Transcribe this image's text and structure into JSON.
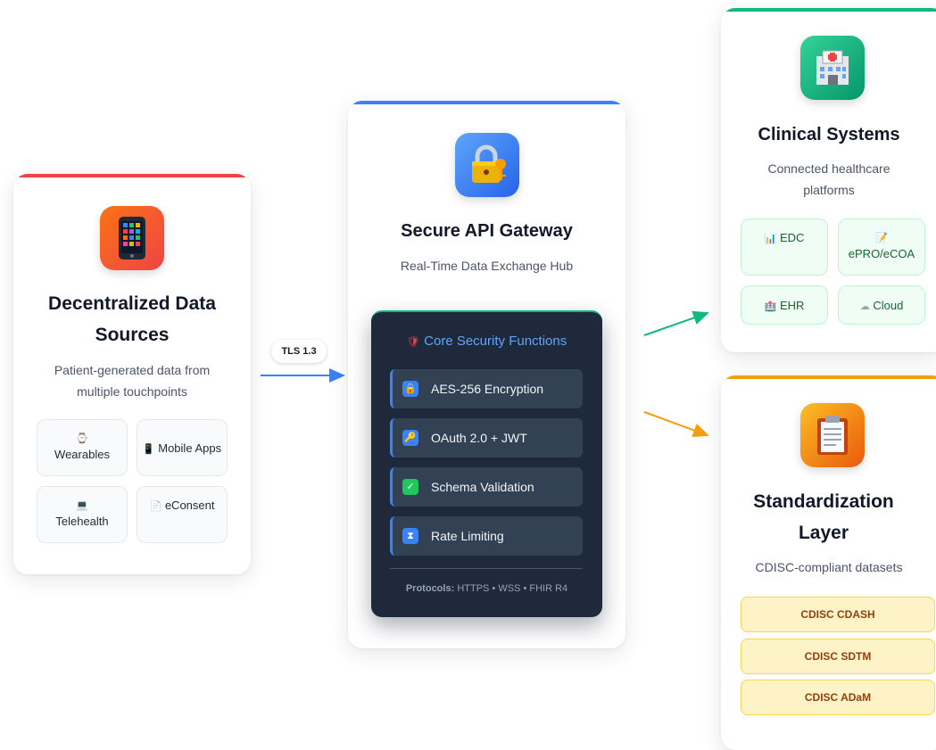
{
  "sources": {
    "title": "Decentralized Data Sources",
    "subtitle": "Patient-generated data from multiple touchpoints",
    "chips": [
      {
        "glyph": "⌚",
        "label": "Wearables"
      },
      {
        "glyph": "📱",
        "label": "Mobile Apps"
      },
      {
        "glyph": "💻",
        "label": "Telehealth"
      },
      {
        "glyph": "📄",
        "label": "eConsent"
      }
    ]
  },
  "connector": {
    "tls_label": "TLS 1.3"
  },
  "gateway": {
    "title": "Secure API Gateway",
    "subtitle": "Real-Time Data Exchange Hub",
    "security": {
      "title": "Core Security Functions",
      "functions": [
        {
          "icon": "lock-icon",
          "label": "AES-256 Encryption"
        },
        {
          "icon": "key-icon",
          "label": "OAuth 2.0 + JWT"
        },
        {
          "icon": "check-icon",
          "label": "Schema Validation"
        },
        {
          "icon": "hourglass-icon",
          "label": "Rate Limiting"
        }
      ],
      "protocols_label": "Protocols:",
      "protocols_value": "HTTPS • WSS • FHIR R4"
    }
  },
  "clinical": {
    "title": "Clinical Systems",
    "subtitle": "Connected healthcare platforms",
    "chips": [
      {
        "glyph": "📊",
        "label": "EDC"
      },
      {
        "glyph": "📝",
        "label": "ePRO/eCOA"
      },
      {
        "glyph": "🏥",
        "label": "EHR"
      },
      {
        "glyph": "☁",
        "label": "Cloud"
      }
    ]
  },
  "standardization": {
    "title": "Standardization Layer",
    "subtitle": "CDISC-compliant datasets",
    "datasets": [
      "CDISC CDASH",
      "CDISC SDTM",
      "CDISC ADaM"
    ]
  },
  "colors": {
    "sources_accent": "#ef4444",
    "gateway_accent": "#3b82f6",
    "clinical_accent": "#10b981",
    "standardization_accent": "#f59e0b",
    "security_panel_bg": "#1e293b"
  }
}
